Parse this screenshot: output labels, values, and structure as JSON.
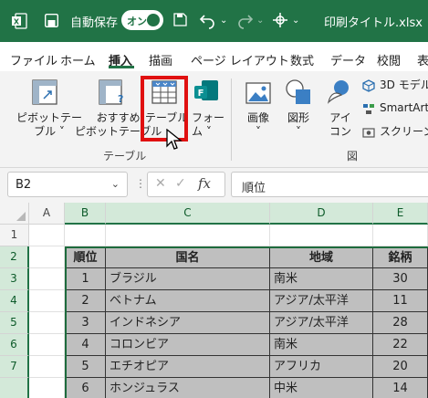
{
  "titlebar": {
    "autosave_label": "自動保存",
    "autosave_state": "オン",
    "filename": "印刷タイトル.xlsx • 保"
  },
  "tabs": [
    "ファイル",
    "ホーム",
    "挿入",
    "描画",
    "ページ レイアウト",
    "数式",
    "データ",
    "校閲",
    "表"
  ],
  "active_tab": "挿入",
  "ribbon": {
    "pivot_label_1": "ピボットテー",
    "pivot_label_2": "ブル ˅",
    "recommended_label_1": "おすすめ",
    "recommended_label_2": "ピボットテーブル",
    "table_label": "テーブル",
    "forms_label_1": "フォー",
    "forms_label_2": "ム ˅",
    "tables_group_label": "テーブル",
    "image_label": "画像",
    "shapes_label": "図形",
    "icons_label_1": "アイ",
    "icons_label_2": "コン",
    "model3d_label": "3D モデル",
    "smartart_label": "SmartArt",
    "screenshot_label": "スクリーンシ",
    "figures_group_label": "図"
  },
  "formula_bar": {
    "name_box": "B2",
    "fx": "fx",
    "formula": "順位"
  },
  "grid": {
    "columns": [
      "A",
      "B",
      "C",
      "D",
      "E"
    ],
    "rows": [
      "1",
      "2",
      "3",
      "4",
      "5",
      "6",
      "7"
    ],
    "header": [
      "順位",
      "国名",
      "地域",
      "銘柄"
    ],
    "data": [
      [
        "1",
        "ブラジル",
        "南米",
        "30"
      ],
      [
        "2",
        "ベトナム",
        "アジア/太平洋",
        "11"
      ],
      [
        "3",
        "インドネシア",
        "アジア/太平洋",
        "28"
      ],
      [
        "4",
        "コロンビア",
        "南米",
        "22"
      ],
      [
        "5",
        "エチオピア",
        "アフリカ",
        "20"
      ],
      [
        "6",
        "ホンジュラス",
        "中米",
        "14"
      ]
    ]
  }
}
